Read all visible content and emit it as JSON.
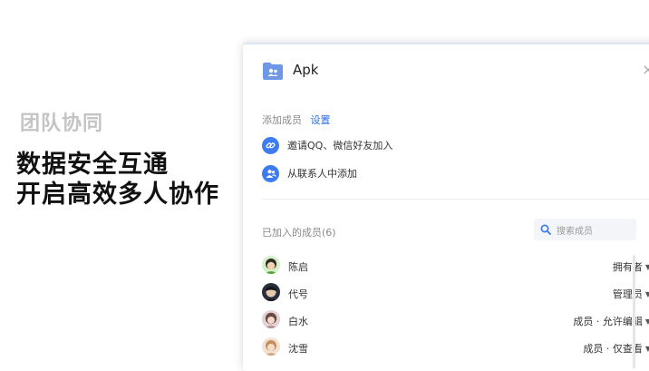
{
  "promo": {
    "subtitle": "团队协同",
    "headline_line1": "数据安全互通",
    "headline_line2": "开启高效多人协作"
  },
  "dialog": {
    "title": "Apk",
    "close_symbol": "×",
    "add_members_label": "添加成员",
    "settings_link": "设置",
    "invite_qq_wechat": "邀请QQ、微信好友加入",
    "add_from_contacts": "从联系人中添加",
    "joined_members_label": "已加入的成员(6)",
    "search_placeholder": "搜索成员",
    "members": [
      {
        "name": "陈启",
        "role": "拥有者"
      },
      {
        "name": "代号",
        "role": "管理员"
      },
      {
        "name": "白水",
        "role": "成员 · 允许编辑"
      },
      {
        "name": "沈雪",
        "role": "成员 · 仅查看"
      }
    ]
  },
  "colors": {
    "accent": "#3d7cf0",
    "link": "#2b6de3",
    "folder": "#6f97e8"
  }
}
